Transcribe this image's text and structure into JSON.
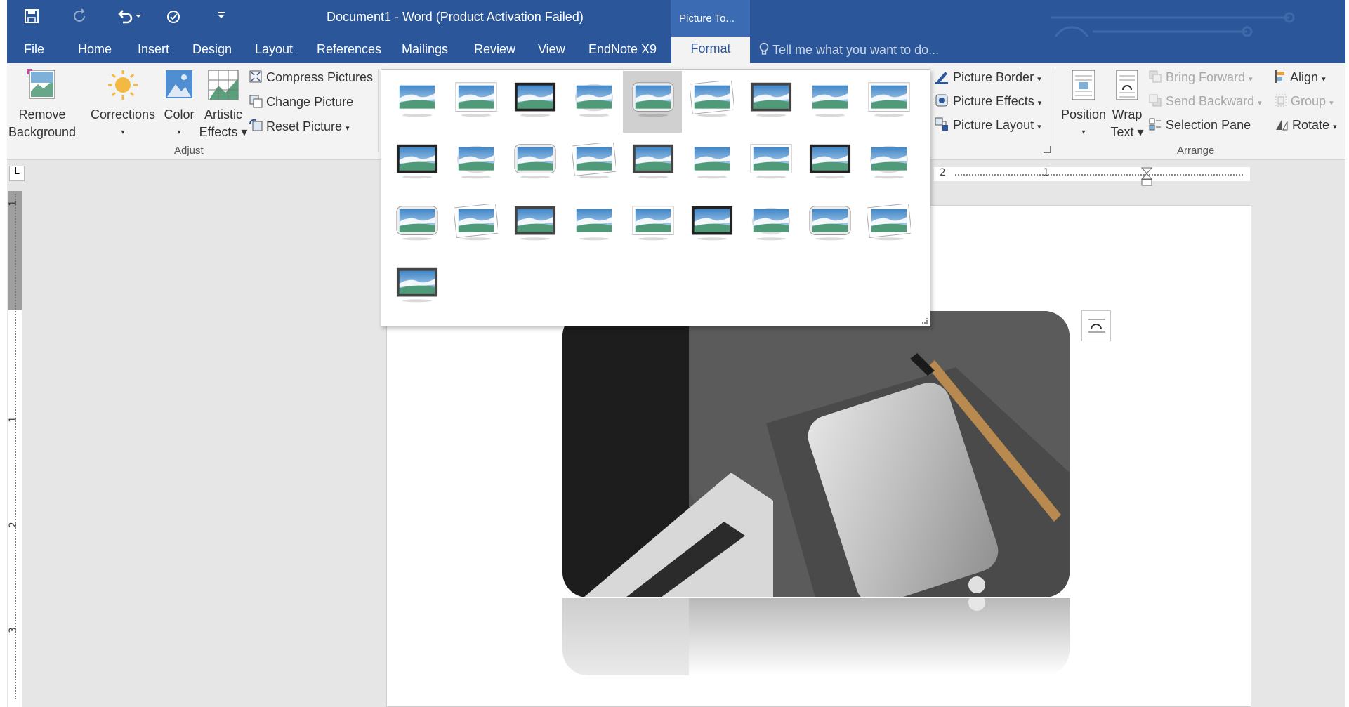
{
  "titlebar": {
    "title": "Document1 - Word (Product Activation Failed)",
    "contextual_tab": "Picture To...",
    "qat": [
      "save-icon",
      "redo-icon",
      "undo-icon",
      "customize-icon"
    ]
  },
  "tabs": [
    "File",
    "Home",
    "Insert",
    "Design",
    "Layout",
    "References",
    "Mailings",
    "Review",
    "View",
    "EndNote X9",
    "Format"
  ],
  "active_tab": "Format",
  "tellme": {
    "placeholder": "Tell me what you want to do..."
  },
  "ribbon": {
    "adjust": {
      "remove_bg": [
        "Remove",
        "Background"
      ],
      "corrections": "Corrections",
      "color": "Color",
      "artistic": [
        "Artistic",
        "Effects"
      ],
      "compress": "Compress Pictures",
      "change": "Change Picture",
      "reset": "Reset Picture",
      "group": "Adjust"
    },
    "styles": {
      "border": "Picture Border",
      "effects": "Picture Effects",
      "layout": "Picture Layout"
    },
    "arrange": {
      "position": "Position",
      "wrap": [
        "Wrap",
        "Text"
      ],
      "bring_forward": "Bring Forward",
      "send_backward": "Send Backward",
      "selection_pane": "Selection Pane",
      "align": "Align",
      "group_btn": "Group",
      "rotate": "Rotate",
      "group": "Arrange"
    }
  },
  "ruler": {
    "h_labels": [
      "2",
      "1"
    ],
    "v_labels": [
      "1",
      "1",
      "2",
      "3"
    ]
  },
  "gallery": {
    "rows": 4,
    "styles_count": 28,
    "selected_index": 4
  }
}
